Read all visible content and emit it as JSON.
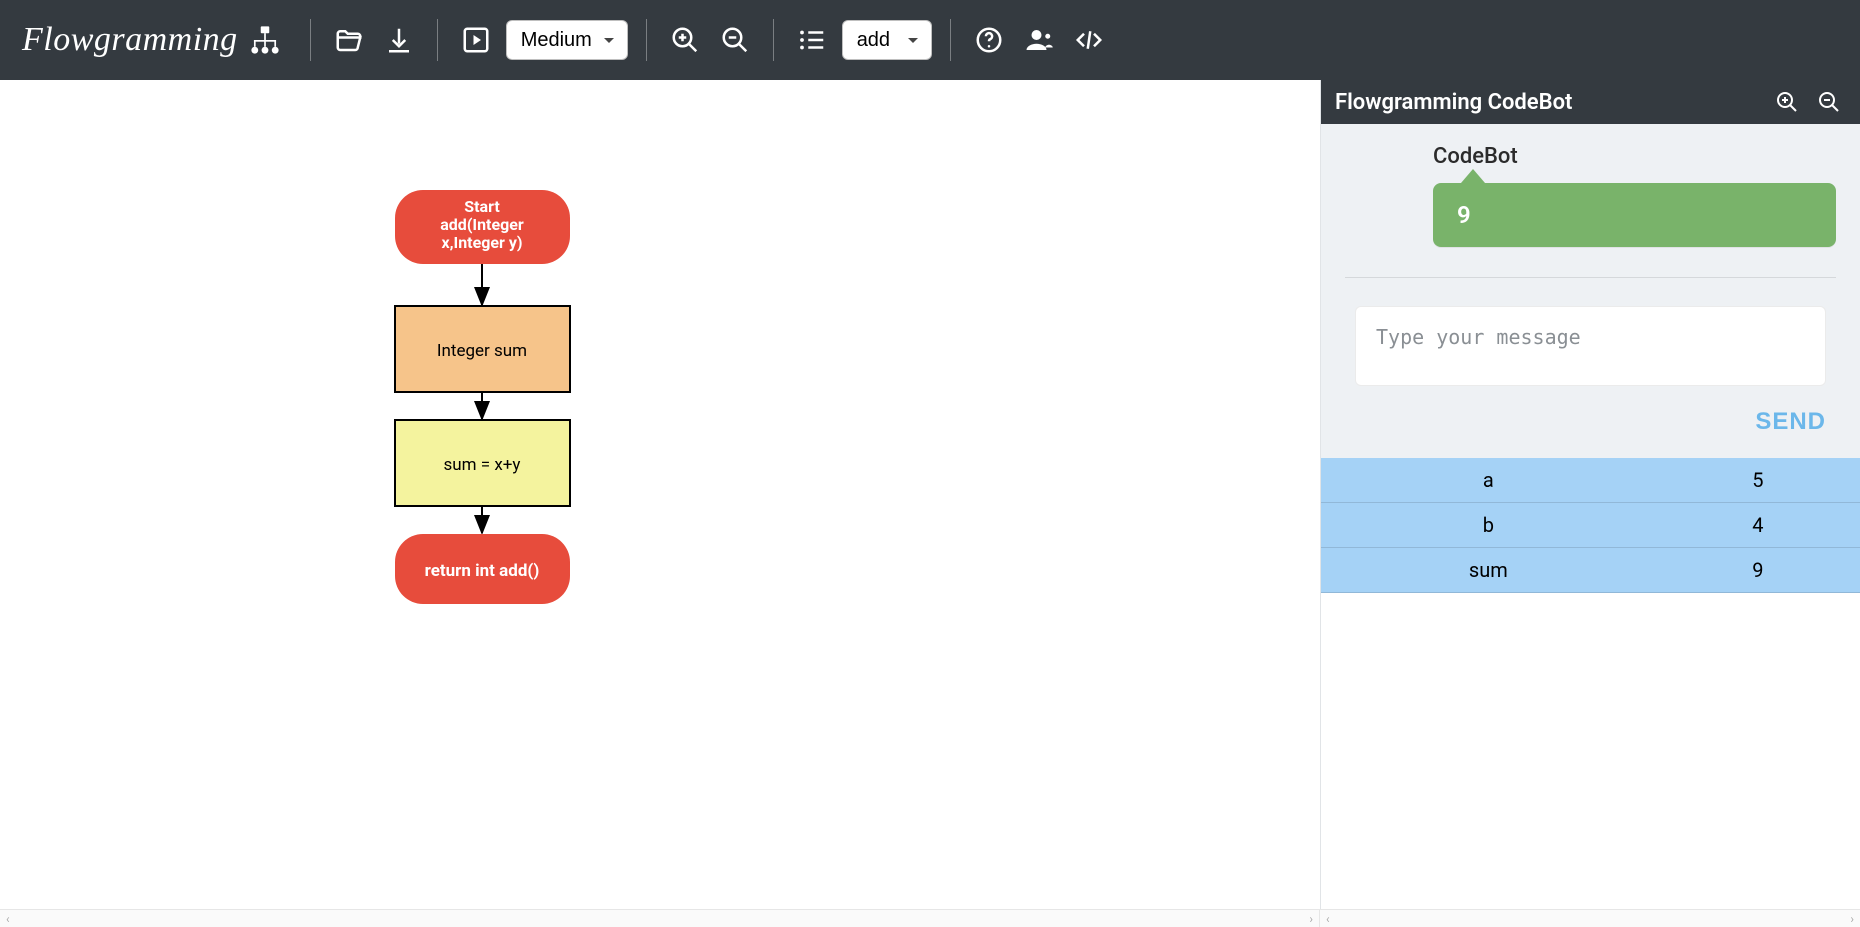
{
  "brand": {
    "name": "Flowgramming"
  },
  "toolbar": {
    "speed_selected": "Medium",
    "func_selected": "add"
  },
  "flowchart": {
    "nodes": {
      "start_line1": "Start",
      "start_line2": "add(Integer",
      "start_line3": "x,Integer y)",
      "declare": "Integer sum",
      "assign": "sum = x+y",
      "return": "return int add()"
    },
    "colors": {
      "terminal": "#e74c3c",
      "declare_fill": "#f6c48a",
      "assign_fill": "#f4f39e",
      "stroke": "#000000",
      "terminal_text": "#ffffff",
      "box_text": "#000000"
    }
  },
  "bot": {
    "panel_title": "Flowgramming CodeBot",
    "from_label": "CodeBot",
    "message": "9",
    "input_placeholder": "Type your message",
    "send_label": "SEND",
    "variables": [
      {
        "name": "a",
        "value": "5"
      },
      {
        "name": "b",
        "value": "4"
      },
      {
        "name": "sum",
        "value": "9"
      }
    ]
  }
}
